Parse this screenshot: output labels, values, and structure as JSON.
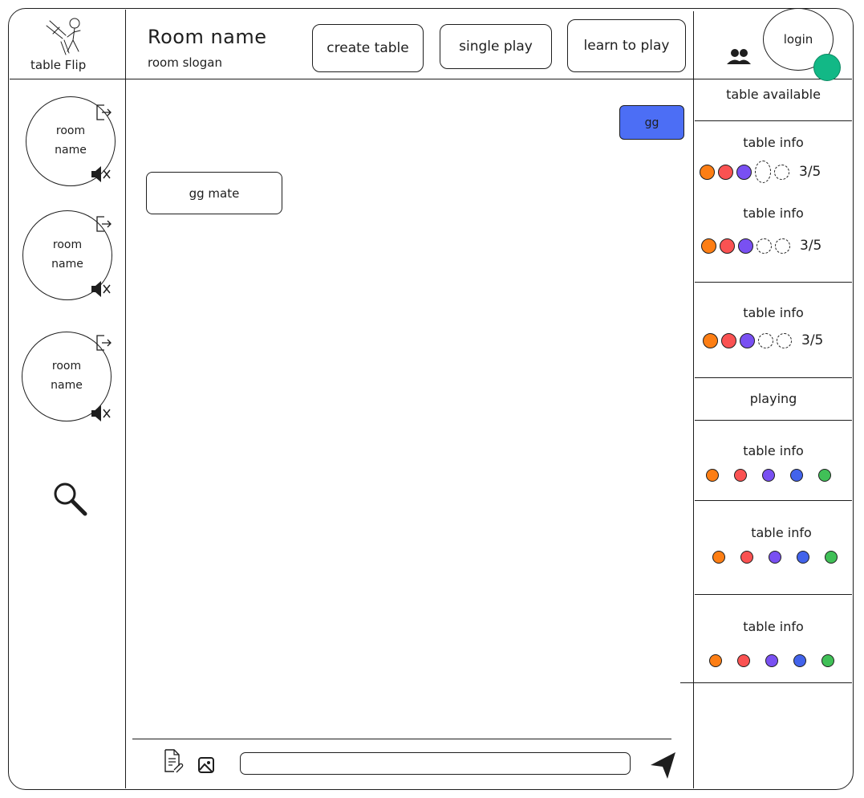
{
  "app": {
    "name": "table Flip"
  },
  "header": {
    "room_title": "Room name",
    "room_slogan": "room slogan",
    "buttons": [
      "create table",
      "single play",
      "learn to play"
    ],
    "login_label": "login",
    "icons": {
      "users": "users-icon",
      "status": "online-status-dot"
    }
  },
  "sidebar": {
    "rooms": [
      {
        "label": "room\nname",
        "exit_icon": "exit-icon",
        "mute_icon": "speaker-muted-icon"
      },
      {
        "label": "room\nname",
        "exit_icon": "exit-icon",
        "mute_icon": "speaker-muted-icon"
      },
      {
        "label": "room\nname",
        "exit_icon": "exit-icon",
        "mute_icon": "speaker-muted-icon"
      }
    ],
    "search_icon": "search-icon"
  },
  "chat": {
    "messages": [
      {
        "text": "gg",
        "from": "self"
      },
      {
        "text": "gg mate",
        "from": "other"
      }
    ],
    "input": {
      "value": "",
      "placeholder": ""
    },
    "icons": {
      "attach": "attach-file-icon",
      "image": "image-icon",
      "send": "send-icon"
    }
  },
  "tables": {
    "available_title": "table available",
    "available": [
      {
        "title": "table info",
        "count": "3/5"
      },
      {
        "title": "table info",
        "count": "3/5"
      },
      {
        "title": "table info",
        "count": "3/5"
      }
    ],
    "playing_title": "playing",
    "playing": [
      {
        "title": "table info"
      },
      {
        "title": "table info"
      },
      {
        "title": "table info"
      }
    ]
  },
  "colors": {
    "self_message": "#4c6ef5",
    "online": "#12b886",
    "player_orange": "#fd7e14",
    "player_red": "#fa5252",
    "player_violet": "#7950f2",
    "player_blue": "#4263eb",
    "player_green": "#40c057"
  }
}
